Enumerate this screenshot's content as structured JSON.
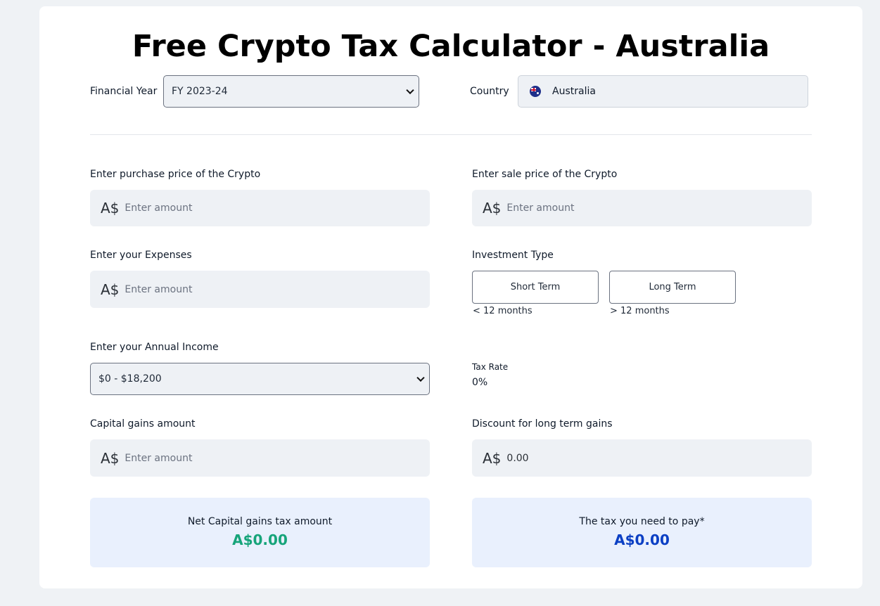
{
  "page_title": "Free Crypto Tax Calculator - Australia",
  "financial_year": {
    "label": "Financial Year",
    "value": "FY 2023-24"
  },
  "country": {
    "label": "Country",
    "value": "Australia",
    "flag_icon": "australia-flag-icon"
  },
  "currency_prefix": "A$",
  "purchase": {
    "label": "Enter purchase price of the Crypto",
    "placeholder": "Enter amount"
  },
  "sale": {
    "label": "Enter sale price of the Crypto",
    "placeholder": "Enter amount"
  },
  "expenses": {
    "label": "Enter your Expenses",
    "placeholder": "Enter amount"
  },
  "investment_type": {
    "label": "Investment Type",
    "options": [
      {
        "label": "Short Term",
        "sub": "< 12 months"
      },
      {
        "label": "Long Term",
        "sub": "> 12 months"
      }
    ]
  },
  "annual_income": {
    "label": "Enter your Annual Income",
    "value": "$0 - $18,200"
  },
  "tax_rate": {
    "label": "Tax Rate",
    "value": "0%"
  },
  "capital_gains": {
    "label": "Capital gains amount",
    "placeholder": "Enter amount"
  },
  "discount": {
    "label": "Discount for long term gains",
    "value": "0.00"
  },
  "net_tax": {
    "label": "Net Capital gains tax amount",
    "value": "A$0.00",
    "color": "#16a47a"
  },
  "tax_to_pay": {
    "label": "The tax you need to pay*",
    "value": "A$0.00",
    "color": "#0b3fc4"
  }
}
